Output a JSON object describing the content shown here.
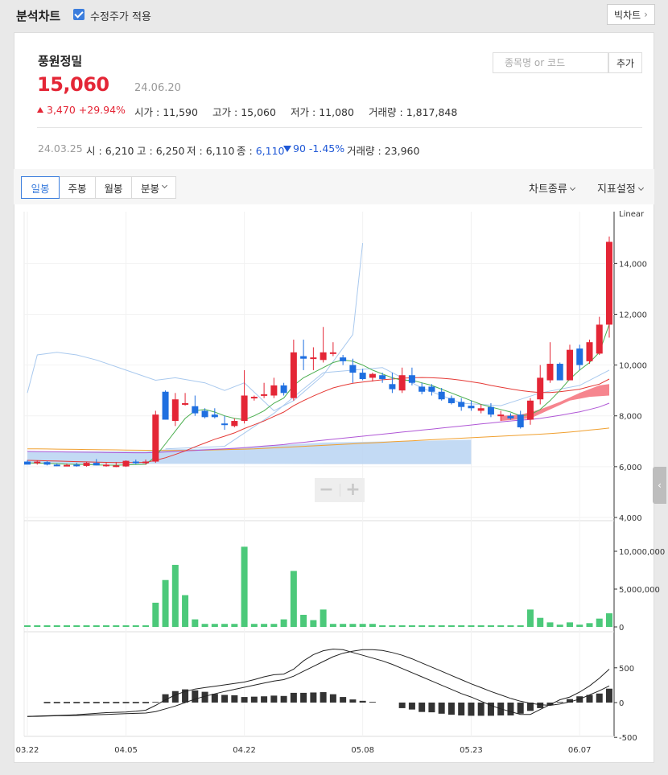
{
  "header": {
    "title": "분석차트",
    "adjusted_price_label": "수정주가 적용",
    "adjusted_price_checked": true,
    "bigchart_label": "빅차트"
  },
  "stock": {
    "name": "풍원정밀",
    "price": "15,060",
    "date": "24.06.20",
    "change": "3,470",
    "change_pct": "+29.94%",
    "open_label": "시가",
    "open": "11,590",
    "high_label": "고가",
    "high": "15,060",
    "low_label": "저가",
    "low": "11,080",
    "volume_label": "거래량",
    "volume": "1,817,848"
  },
  "search": {
    "placeholder": "종목명 or 코드",
    "add_label": "추가"
  },
  "prev_day": {
    "date": "24.03.25",
    "open_label": "시",
    "open": "6,210",
    "high_label": "고",
    "high": "6,250",
    "low_label": "저",
    "low": "6,110",
    "close_label": "종",
    "close": "6,110",
    "change": "90",
    "change_pct": "-1.45%",
    "volume_label": "거래량",
    "volume": "23,960"
  },
  "toolbar": {
    "tabs": [
      "일봉",
      "주봉",
      "월봉",
      "분봉"
    ],
    "active_tab": "일봉",
    "chart_type_label": "차트종류",
    "indicator_label": "지표설정"
  },
  "colors": {
    "up": "#e42636",
    "down": "#1f6fe0",
    "volume": "#4cc97a",
    "macd_hist": "#333333",
    "ma5": "#4caf50",
    "ma20": "#e53935",
    "ma60": "#b057d6",
    "ma120": "#f0a030",
    "cloud_blue": "#b9d3f2",
    "cloud_red": "#f4707a"
  },
  "chart_data": {
    "type": "candlestick",
    "price_scale": "Linear",
    "price_ticks": [
      "14,000",
      "12,000",
      "10,000",
      "8,000",
      "6,000",
      "4,000"
    ],
    "volume_ticks": [
      "10,000,000",
      "5,000,000",
      "0"
    ],
    "macd_ticks": [
      "500",
      "0",
      "-500"
    ],
    "x_ticks": [
      "03.22",
      "04.05",
      "04.22",
      "05.08",
      "05.23",
      "06.07"
    ],
    "candles": [
      {
        "o": 6200,
        "h": 6260,
        "l": 6100,
        "c": 6080
      },
      {
        "o": 6150,
        "h": 6250,
        "l": 6080,
        "c": 6200
      },
      {
        "o": 6180,
        "h": 6220,
        "l": 6050,
        "c": 6080
      },
      {
        "o": 6080,
        "h": 6120,
        "l": 6020,
        "c": 6060
      },
      {
        "o": 6050,
        "h": 6120,
        "l": 6010,
        "c": 6070
      },
      {
        "o": 6080,
        "h": 6150,
        "l": 6000,
        "c": 6020
      },
      {
        "o": 6030,
        "h": 6200,
        "l": 6000,
        "c": 6150
      },
      {
        "o": 6150,
        "h": 6300,
        "l": 6050,
        "c": 6050
      },
      {
        "o": 6050,
        "h": 6150,
        "l": 6000,
        "c": 6080
      },
      {
        "o": 6020,
        "h": 6180,
        "l": 5980,
        "c": 6050
      },
      {
        "o": 6010,
        "h": 6250,
        "l": 5990,
        "c": 6230
      },
      {
        "o": 6200,
        "h": 6280,
        "l": 6100,
        "c": 6150
      },
      {
        "o": 6150,
        "h": 6280,
        "l": 6080,
        "c": 6200
      },
      {
        "o": 6200,
        "h": 8200,
        "l": 6150,
        "c": 8050
      },
      {
        "o": 8950,
        "h": 9000,
        "l": 7850,
        "c": 7850
      },
      {
        "o": 7800,
        "h": 8900,
        "l": 7600,
        "c": 8650
      },
      {
        "o": 8450,
        "h": 8900,
        "l": 8400,
        "c": 8500
      },
      {
        "o": 8380,
        "h": 8800,
        "l": 8000,
        "c": 8100
      },
      {
        "o": 8200,
        "h": 8300,
        "l": 7900,
        "c": 7950
      },
      {
        "o": 8050,
        "h": 8300,
        "l": 7900,
        "c": 7950
      },
      {
        "o": 7700,
        "h": 8000,
        "l": 7450,
        "c": 7650
      },
      {
        "o": 7600,
        "h": 7900,
        "l": 7550,
        "c": 7800
      },
      {
        "o": 7800,
        "h": 9800,
        "l": 7700,
        "c": 8800
      },
      {
        "o": 8700,
        "h": 8800,
        "l": 8600,
        "c": 8750
      },
      {
        "o": 8800,
        "h": 9300,
        "l": 8700,
        "c": 8850
      },
      {
        "o": 8800,
        "h": 9500,
        "l": 8700,
        "c": 9200
      },
      {
        "o": 9200,
        "h": 9300,
        "l": 8800,
        "c": 8900
      },
      {
        "o": 8700,
        "h": 11000,
        "l": 8600,
        "c": 10500
      },
      {
        "o": 10350,
        "h": 11000,
        "l": 9800,
        "c": 10250
      },
      {
        "o": 10250,
        "h": 10700,
        "l": 9800,
        "c": 10300
      },
      {
        "o": 10200,
        "h": 11500,
        "l": 10100,
        "c": 10500
      },
      {
        "o": 10450,
        "h": 10900,
        "l": 10350,
        "c": 10500
      },
      {
        "o": 10300,
        "h": 10400,
        "l": 10000,
        "c": 10150
      },
      {
        "o": 10000,
        "h": 10250,
        "l": 9300,
        "c": 9700
      },
      {
        "o": 9700,
        "h": 9850,
        "l": 9400,
        "c": 9450
      },
      {
        "o": 9500,
        "h": 9700,
        "l": 9350,
        "c": 9650
      },
      {
        "o": 9600,
        "h": 9700,
        "l": 9300,
        "c": 9450
      },
      {
        "o": 9250,
        "h": 9700,
        "l": 8900,
        "c": 9050
      },
      {
        "o": 9000,
        "h": 9900,
        "l": 8900,
        "c": 9600
      },
      {
        "o": 9600,
        "h": 9900,
        "l": 9200,
        "c": 9300
      },
      {
        "o": 9150,
        "h": 9300,
        "l": 8850,
        "c": 8950
      },
      {
        "o": 9150,
        "h": 9250,
        "l": 8800,
        "c": 8950
      },
      {
        "o": 8950,
        "h": 9100,
        "l": 8600,
        "c": 8650
      },
      {
        "o": 8700,
        "h": 8800,
        "l": 8450,
        "c": 8500
      },
      {
        "o": 8550,
        "h": 8700,
        "l": 8200,
        "c": 8350
      },
      {
        "o": 8400,
        "h": 8600,
        "l": 8200,
        "c": 8300
      },
      {
        "o": 8200,
        "h": 8450,
        "l": 8100,
        "c": 8300
      },
      {
        "o": 8350,
        "h": 8500,
        "l": 7950,
        "c": 8050
      },
      {
        "o": 8000,
        "h": 8200,
        "l": 7800,
        "c": 8050
      },
      {
        "o": 8000,
        "h": 8100,
        "l": 7850,
        "c": 7900
      },
      {
        "o": 8050,
        "h": 8200,
        "l": 7500,
        "c": 7550
      },
      {
        "o": 7850,
        "h": 8700,
        "l": 7650,
        "c": 8600
      },
      {
        "o": 8650,
        "h": 10000,
        "l": 8450,
        "c": 9500
      },
      {
        "o": 9400,
        "h": 10900,
        "l": 9300,
        "c": 10050
      },
      {
        "o": 10050,
        "h": 10100,
        "l": 9400,
        "c": 9400
      },
      {
        "o": 9400,
        "h": 10800,
        "l": 9400,
        "c": 10600
      },
      {
        "o": 10650,
        "h": 10800,
        "l": 9800,
        "c": 10000
      },
      {
        "o": 10150,
        "h": 11000,
        "l": 10050,
        "c": 10900
      },
      {
        "o": 10450,
        "h": 11900,
        "l": 10400,
        "c": 11590
      },
      {
        "o": 11590,
        "h": 15060,
        "l": 11080,
        "c": 14850
      }
    ],
    "volume": [
      0.05,
      0.05,
      0.05,
      0.05,
      0.05,
      0.05,
      0.05,
      0.05,
      0.05,
      0.05,
      0.05,
      0.05,
      0.05,
      3.2,
      6.2,
      8.2,
      4.2,
      1.0,
      0.4,
      0.4,
      0.4,
      0.4,
      10.6,
      0.4,
      0.4,
      0.4,
      1.0,
      7.4,
      1.6,
      0.9,
      2.3,
      0.4,
      0.4,
      0.4,
      0.4,
      0.4,
      0.1,
      0.1,
      0.05,
      0.05,
      0.05,
      0.05,
      0.05,
      0.05,
      0.05,
      0.05,
      0.05,
      0.05,
      0.05,
      0.05,
      0.05,
      2.3,
      1.2,
      0.6,
      0.3,
      0.6,
      0.3,
      0.5,
      1.1,
      1.8
    ],
    "macd_hist": [
      0,
      0,
      0,
      0,
      0,
      0,
      0,
      0,
      0,
      0,
      0,
      0,
      0,
      10,
      120,
      165,
      190,
      175,
      155,
      125,
      110,
      105,
      80,
      85,
      90,
      100,
      95,
      140,
      140,
      145,
      150,
      120,
      80,
      45,
      25,
      10,
      0,
      0,
      -80,
      -100,
      -135,
      -140,
      -160,
      -175,
      -185,
      -190,
      -190,
      -190,
      -185,
      -185,
      -160,
      -120,
      -80,
      -40,
      10,
      50,
      90,
      110,
      130,
      200
    ],
    "macd_line": [
      -200,
      -195,
      -190,
      -185,
      -180,
      -175,
      -165,
      -155,
      -145,
      -140,
      -135,
      -125,
      -110,
      -40,
      40,
      110,
      160,
      195,
      215,
      235,
      255,
      275,
      295,
      330,
      370,
      400,
      410,
      480,
      600,
      690,
      745,
      770,
      760,
      720,
      680,
      640,
      600,
      550,
      490,
      430,
      370,
      310,
      250,
      190,
      130,
      80,
      20,
      -40,
      -90,
      -130,
      -170,
      -170,
      -100,
      -30,
      40,
      80,
      150,
      240,
      350,
      480
    ],
    "signal_line": [
      -200,
      -198,
      -195,
      -190,
      -188,
      -185,
      -180,
      -175,
      -170,
      -165,
      -160,
      -155,
      -150,
      -130,
      -90,
      -50,
      0,
      50,
      90,
      125,
      160,
      190,
      220,
      250,
      280,
      310,
      330,
      380,
      450,
      520,
      590,
      660,
      710,
      740,
      760,
      760,
      750,
      720,
      680,
      630,
      570,
      510,
      450,
      390,
      330,
      270,
      215,
      160,
      110,
      60,
      20,
      -10,
      -30,
      -40,
      -20,
      10,
      50,
      110,
      170,
      240
    ],
    "ma5": [
      6150,
      6140,
      6130,
      6120,
      6100,
      6090,
      6080,
      6070,
      6060,
      6060,
      6070,
      6080,
      6090,
      6400,
      6900,
      7400,
      7900,
      8200,
      8250,
      8150,
      8000,
      7900,
      7850,
      8000,
      8200,
      8500,
      8700,
      9200,
      9500,
      9700,
      9900,
      10100,
      10200,
      10150,
      10000,
      9800,
      9650,
      9500,
      9400,
      9400,
      9300,
      9200,
      9050,
      8900,
      8750,
      8600,
      8450,
      8350,
      8250,
      8150,
      8000,
      8050,
      8250,
      8600,
      9000,
      9450,
      9800,
      10100,
      10500,
      11600
    ],
    "ma20": [
      6250,
      6240,
      6230,
      6220,
      6210,
      6200,
      6190,
      6180,
      6170,
      6160,
      6160,
      6160,
      6170,
      6250,
      6350,
      6480,
      6620,
      6780,
      6930,
      7080,
      7200,
      7330,
      7500,
      7650,
      7800,
      7980,
      8150,
      8400,
      8600,
      8780,
      8950,
      9100,
      9200,
      9280,
      9330,
      9380,
      9420,
      9450,
      9480,
      9500,
      9510,
      9500,
      9480,
      9450,
      9400,
      9340,
      9280,
      9200,
      9130,
      9060,
      9000,
      8950,
      8920,
      8920,
      8950,
      9000,
      9050,
      9150,
      9250,
      9450
    ],
    "ma60": [
      6600,
      6595,
      6590,
      6585,
      6580,
      6575,
      6570,
      6565,
      6560,
      6555,
      6550,
      6548,
      6546,
      6560,
      6580,
      6600,
      6620,
      6640,
      6660,
      6680,
      6700,
      6720,
      6750,
      6780,
      6810,
      6840,
      6870,
      6920,
      6960,
      7000,
      7040,
      7080,
      7120,
      7160,
      7200,
      7240,
      7280,
      7320,
      7360,
      7400,
      7440,
      7480,
      7520,
      7560,
      7600,
      7640,
      7680,
      7720,
      7760,
      7800,
      7830,
      7860,
      7900,
      7960,
      8020,
      8090,
      8160,
      8250,
      8350,
      8500
    ],
    "ma120": [
      6700,
      6700,
      6695,
      6690,
      6685,
      6680,
      6675,
      6670,
      6665,
      6660,
      6655,
      6650,
      6645,
      6640,
      6640,
      6640,
      6640,
      6645,
      6650,
      6660,
      6670,
      6680,
      6690,
      6700,
      6720,
      6740,
      6760,
      6780,
      6800,
      6820,
      6840,
      6860,
      6880,
      6900,
      6920,
      6940,
      6960,
      6980,
      7000,
      7020,
      7040,
      7060,
      7080,
      7100,
      7120,
      7140,
      7160,
      7180,
      7200,
      7220,
      7240,
      7260,
      7280,
      7300,
      7330,
      7360,
      7400,
      7440,
      7480,
      7520
    ]
  }
}
